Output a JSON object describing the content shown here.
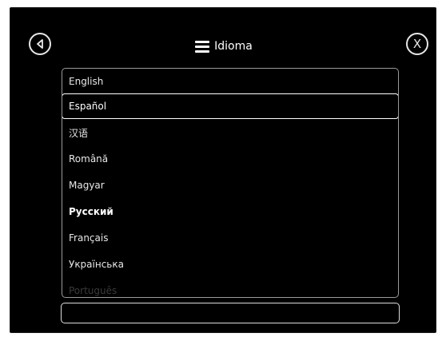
{
  "header": {
    "title": "Idioma"
  },
  "buttons": {
    "close_label": "X"
  },
  "languages": [
    {
      "label": "English"
    },
    {
      "label": "Español"
    },
    {
      "label": "汉语"
    },
    {
      "label": "Română"
    },
    {
      "label": "Magyar"
    },
    {
      "label": "Русский"
    },
    {
      "label": "Français"
    },
    {
      "label": "Українська"
    },
    {
      "label": "Português"
    }
  ],
  "selected_language": "Español",
  "colors": {
    "background": "#000000",
    "text": "#e8e8e8",
    "border": "#ffffff"
  }
}
